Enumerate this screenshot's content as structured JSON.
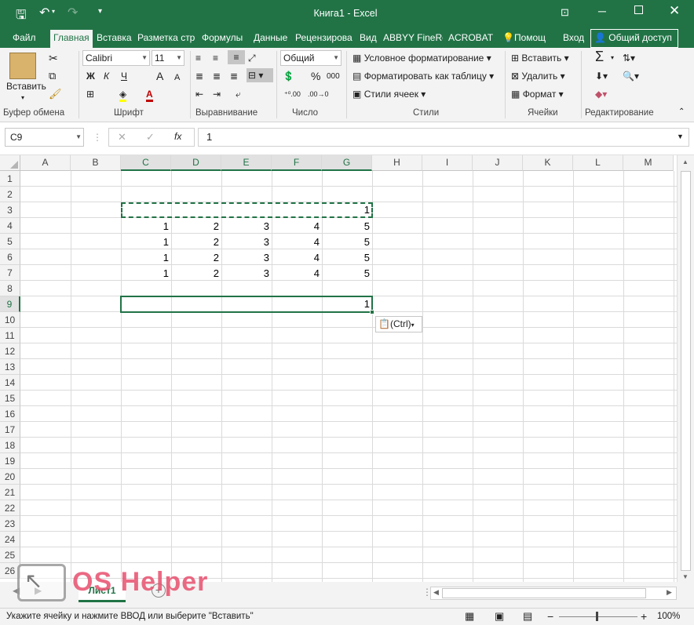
{
  "window": {
    "title": "Книга1 - Excel"
  },
  "tabs": [
    {
      "label": "Файл",
      "active": false
    },
    {
      "label": "Главная",
      "active": true
    },
    {
      "label": "Вставка",
      "active": false
    },
    {
      "label": "Разметка стр",
      "active": false
    },
    {
      "label": "Формулы",
      "active": false
    },
    {
      "label": "Данные",
      "active": false
    },
    {
      "label": "Рецензирова",
      "active": false
    },
    {
      "label": "Вид",
      "active": false
    },
    {
      "label": "ABBYY FineRe",
      "active": false
    },
    {
      "label": "ACROBAT",
      "active": false
    }
  ],
  "help": {
    "label": "Помощ"
  },
  "signin": {
    "label": "Вход"
  },
  "share": {
    "label": "Общий доступ"
  },
  "ribbon": {
    "clipboard": {
      "paste": "Вставить",
      "group": "Буфер обмена"
    },
    "font": {
      "name": "Calibri",
      "size": "11",
      "bold": "Ж",
      "italic": "К",
      "underline": "Ч",
      "grow": "A",
      "shrink": "A",
      "group": "Шрифт"
    },
    "alignment": {
      "group": "Выравнивание"
    },
    "number": {
      "format": "Общий",
      "percent": "%",
      "thousands": "000",
      "group": "Число"
    },
    "styles": {
      "conditional": "Условное форматирование",
      "as_table": "Форматировать как таблицу",
      "cell_styles": "Стили ячеек",
      "group": "Стили"
    },
    "cells": {
      "insert": "Вставить",
      "delete": "Удалить",
      "format": "Формат",
      "group": "Ячейки"
    },
    "editing": {
      "sum": "Σ",
      "group": "Редактирование"
    }
  },
  "formula_bar": {
    "name_box": "C9",
    "fx": "fx",
    "value": "1"
  },
  "columns": [
    "A",
    "B",
    "C",
    "D",
    "E",
    "F",
    "G",
    "H",
    "I",
    "J",
    "K",
    "L",
    "M"
  ],
  "rows": [
    "1",
    "2",
    "3",
    "4",
    "5",
    "6",
    "7",
    "8",
    "9",
    "10",
    "11",
    "12",
    "13",
    "14",
    "15",
    "16",
    "17",
    "18",
    "19",
    "20",
    "21",
    "22",
    "23",
    "24",
    "25",
    "26"
  ],
  "cells": {
    "r3": {
      "G": "1"
    },
    "r4": {
      "C": "1",
      "D": "2",
      "E": "3",
      "F": "4",
      "G": "5"
    },
    "r5": {
      "C": "1",
      "D": "2",
      "E": "3",
      "F": "4",
      "G": "5"
    },
    "r6": {
      "C": "1",
      "D": "2",
      "E": "3",
      "F": "4",
      "G": "5"
    },
    "r7": {
      "C": "1",
      "D": "2",
      "E": "3",
      "F": "4",
      "G": "5"
    },
    "r9": {
      "G": "1"
    }
  },
  "paste_options": {
    "label": "(Ctrl)"
  },
  "sheet": {
    "name": "Лист1"
  },
  "watermark": {
    "text": "OS Helper"
  },
  "status": {
    "message": "Укажите ячейку и нажмите ВВОД или выберите \"Вставить\"",
    "zoom": "100%"
  },
  "colors": {
    "accent": "#217346",
    "selection": "#217346"
  }
}
